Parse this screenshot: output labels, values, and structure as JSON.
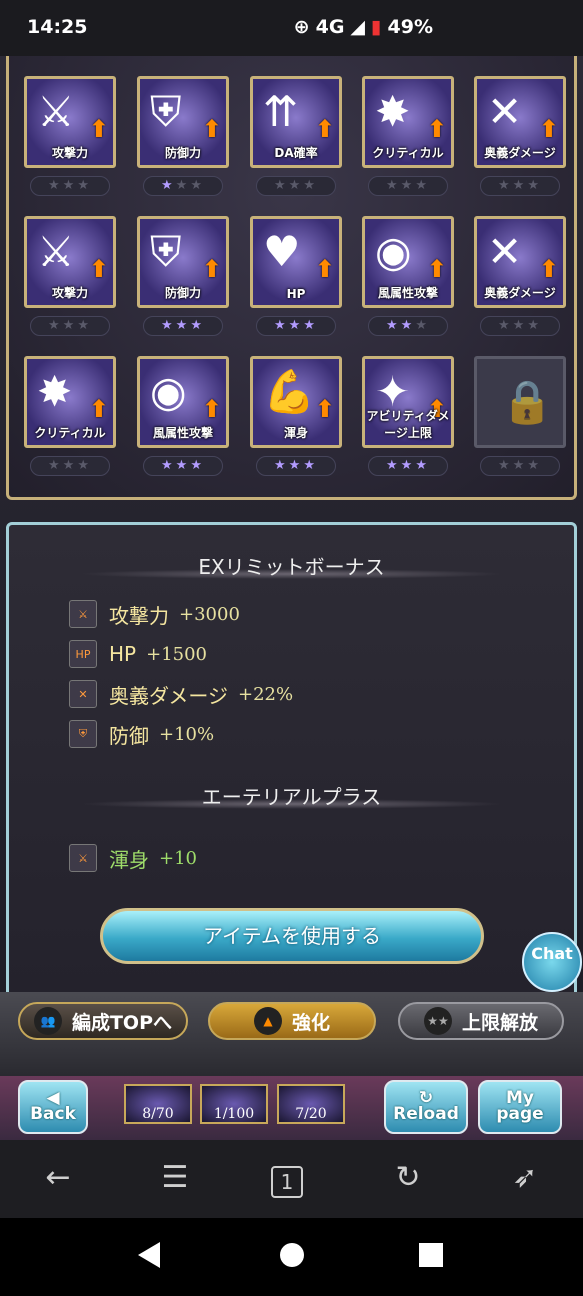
{
  "status": {
    "time": "14:25",
    "network": "4G",
    "battery": "49%"
  },
  "skills": [
    {
      "label": "攻撃力",
      "stars": 0
    },
    {
      "label": "防御力",
      "stars": 1
    },
    {
      "label": "DA確率",
      "stars": 0
    },
    {
      "label": "クリティカル",
      "stars": 0
    },
    {
      "label": "奥義ダメージ",
      "stars": 0
    },
    {
      "label": "攻撃力",
      "stars": 0
    },
    {
      "label": "防御力",
      "stars": 3
    },
    {
      "label": "HP",
      "stars": 3
    },
    {
      "label": "風属性攻撃",
      "stars": 2
    },
    {
      "label": "奥義ダメージ",
      "stars": 0
    },
    {
      "label": "クリティカル",
      "stars": 0
    },
    {
      "label": "風属性攻撃",
      "stars": 3
    },
    {
      "label": "渾身",
      "stars": 3
    },
    {
      "label": "アビリティダメージ上限",
      "stars": 3
    },
    {
      "label": "",
      "stars": 0,
      "locked": true
    }
  ],
  "ex_bonus": {
    "title": "EXリミットボーナス",
    "rows": [
      {
        "name": "攻撃力",
        "value": "+3000",
        "icon": "sword-icon"
      },
      {
        "name": "HP",
        "value": "+1500",
        "icon": "hp-icon"
      },
      {
        "name": "奥義ダメージ",
        "value": "+22%",
        "icon": "ougi-icon"
      },
      {
        "name": "防御",
        "value": "+10%",
        "icon": "shield-icon"
      }
    ]
  },
  "ethereal": {
    "title": "エーテリアルプラス",
    "rows": [
      {
        "name": "渾身",
        "value": "+10",
        "icon": "sword-icon"
      }
    ]
  },
  "use_item_label": "アイテムを使用する",
  "chat_label": "Chat",
  "actions": {
    "team_top": "編成TOPへ",
    "enhance": "強化",
    "uncap": "上限解放"
  },
  "nav": {
    "back": "Back",
    "reload": "Reload",
    "mypage_line1": "My",
    "mypage_line2": "page",
    "counts": [
      "8/70",
      "1/100",
      "7/20"
    ]
  }
}
